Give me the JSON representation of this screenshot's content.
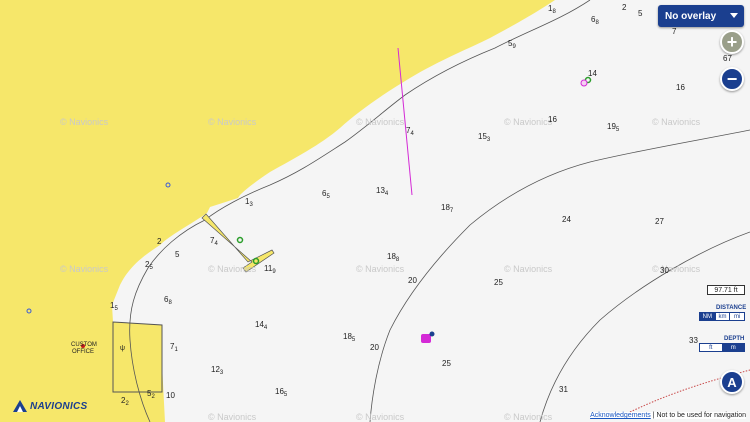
{
  "overlay": {
    "selected": "No overlay"
  },
  "controls": {
    "zoom_in": "+",
    "zoom_out": "−",
    "navigate": "A"
  },
  "scale": {
    "value": "97.71",
    "unit": "ft"
  },
  "distance_units": {
    "label": "DISTANCE",
    "options": [
      "NM",
      "km",
      "mi"
    ],
    "selected": "NM"
  },
  "depth_units": {
    "label": "DEPTH",
    "options": [
      "ft",
      "m"
    ],
    "selected": "m"
  },
  "footer": {
    "ack_link": "Acknowledgements",
    "separator": " | ",
    "disclaimer": "Not to be used for navigation"
  },
  "brand": {
    "logo_text": "NAVIONICS",
    "watermark": "© Navionics"
  },
  "poi": {
    "customs_office": [
      "CUSTOM",
      "OFFICE"
    ]
  },
  "colors": {
    "land": "#f6e76a",
    "water": "#f5f5f5",
    "brand_blue": "#1b3f8f",
    "marker_magenta": "#d42ad6"
  },
  "depths": [
    {
      "main": "1",
      "sub": "8"
    },
    {
      "main": "2",
      "sub": ""
    },
    {
      "main": "5",
      "sub": ""
    },
    {
      "main": "6",
      "sub": "8"
    },
    {
      "main": "7",
      "sub": ""
    },
    {
      "main": "5",
      "sub": "9"
    },
    {
      "main": "14",
      "sub": ""
    },
    {
      "main": "16",
      "sub": ""
    },
    {
      "main": "67",
      "sub": ""
    },
    {
      "main": "7",
      "sub": "4"
    },
    {
      "main": "15",
      "sub": "3"
    },
    {
      "main": "16",
      "sub": ""
    },
    {
      "main": "19",
      "sub": "5"
    },
    {
      "main": "13",
      "sub": "4"
    },
    {
      "main": "6",
      "sub": "5"
    },
    {
      "main": "18",
      "sub": "7"
    },
    {
      "main": "24",
      "sub": ""
    },
    {
      "main": "27",
      "sub": ""
    },
    {
      "main": "1",
      "sub": "3"
    },
    {
      "main": "7",
      "sub": "4"
    },
    {
      "main": "2",
      "sub": ""
    },
    {
      "main": "5",
      "sub": ""
    },
    {
      "main": "2",
      "sub": "5"
    },
    {
      "main": "11",
      "sub": "9"
    },
    {
      "main": "18",
      "sub": "8"
    },
    {
      "main": "20",
      "sub": ""
    },
    {
      "main": "25",
      "sub": ""
    },
    {
      "main": "30",
      "sub": ""
    },
    {
      "main": "1",
      "sub": "5"
    },
    {
      "main": "6",
      "sub": "8"
    },
    {
      "main": "14",
      "sub": "4"
    },
    {
      "main": "18",
      "sub": "5"
    },
    {
      "main": "20",
      "sub": ""
    },
    {
      "main": "7",
      "sub": "1"
    },
    {
      "main": "12",
      "sub": "3"
    },
    {
      "main": "25",
      "sub": ""
    },
    {
      "main": "33",
      "sub": ""
    },
    {
      "main": "16",
      "sub": "5"
    },
    {
      "main": "31",
      "sub": ""
    },
    {
      "main": "2",
      "sub": "2"
    },
    {
      "main": "5",
      "sub": "2"
    },
    {
      "main": "10",
      "sub": ""
    }
  ]
}
